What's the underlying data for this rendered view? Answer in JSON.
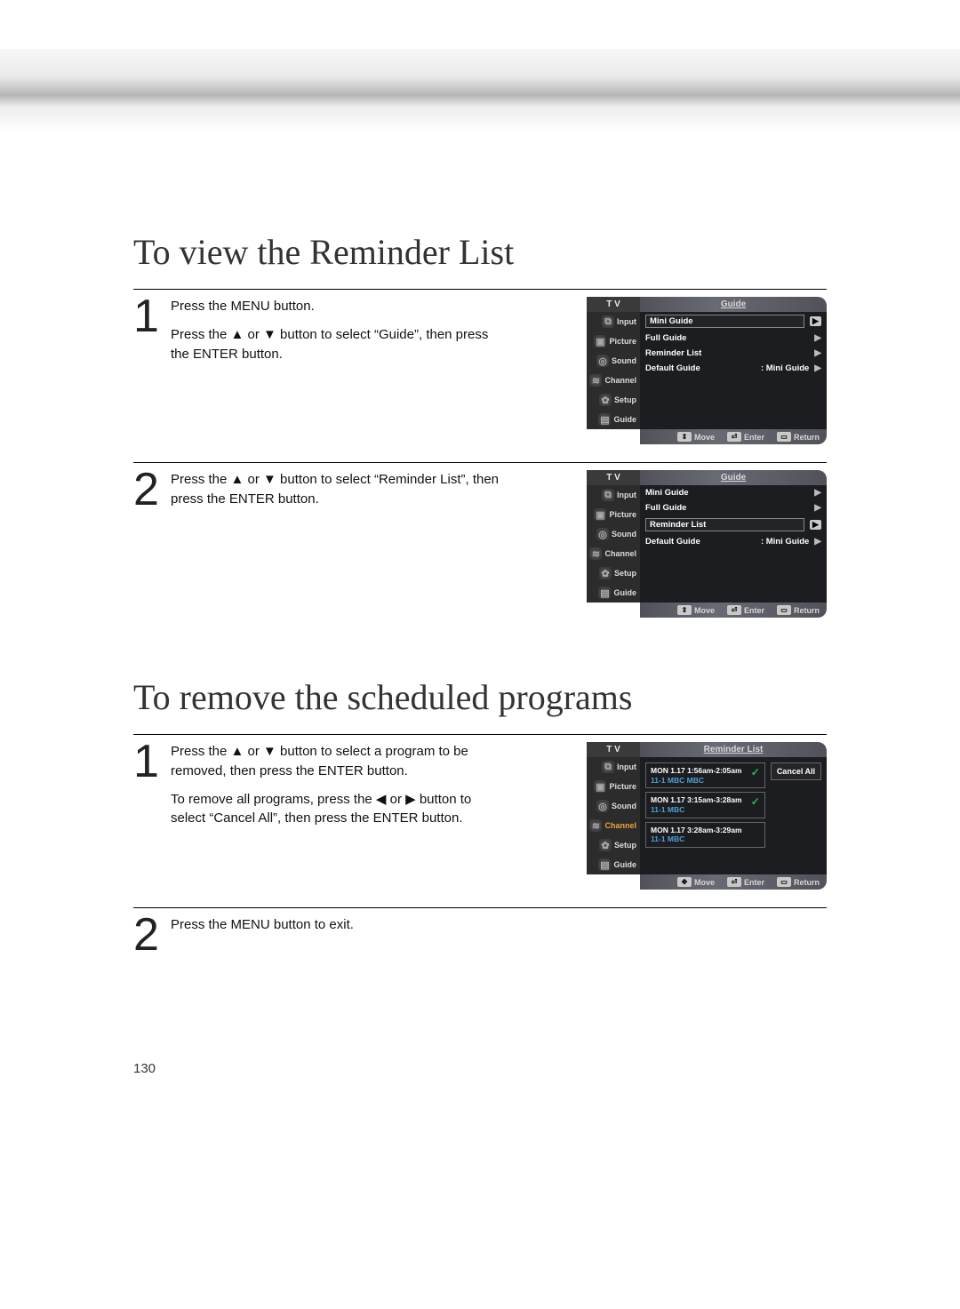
{
  "page_number": "130",
  "section1": {
    "title": "To view the Reminder List",
    "steps": [
      {
        "num": "1",
        "lines": [
          "Press the MENU button.",
          "Press the ▲ or ▼ button to select “Guide”, then press the ENTER button."
        ]
      },
      {
        "num": "2",
        "lines": [
          "Press the ▲ or ▼ button to select “Reminder List”, then press the ENTER button."
        ]
      }
    ]
  },
  "section2": {
    "title": "To remove the scheduled programs",
    "steps": [
      {
        "num": "1",
        "lines": [
          "Press the ▲ or ▼ button to select a program to be removed, then press the ENTER button.",
          "To remove all programs, press the ◀ or ▶ button to select “Cancel All”, then press the ENTER button."
        ]
      },
      {
        "num": "2",
        "lines": [
          "Press the MENU button to exit."
        ]
      }
    ]
  },
  "osd_common": {
    "tv_label": "T V",
    "sidebar": [
      "Input",
      "Picture",
      "Sound",
      "Channel",
      "Setup",
      "Guide"
    ],
    "footer": {
      "move": "Move",
      "enter": "Enter",
      "return": "Return"
    }
  },
  "osd_guide": {
    "title": "Guide",
    "options": [
      {
        "label": "Mini Guide",
        "value": ""
      },
      {
        "label": "Full Guide",
        "value": ""
      },
      {
        "label": "Reminder List",
        "value": ""
      },
      {
        "label": "Default Guide",
        "value": ": Mini Guide"
      }
    ]
  },
  "osd_reminder": {
    "title": "Reminder List",
    "cancel_all": "Cancel All",
    "items": [
      {
        "line1": "MON 1.17 1:56am-2:05am",
        "line2": "11-1  MBC     MBC"
      },
      {
        "line1": "MON 1.17 3:15am-3:28am",
        "line2": "11-1  MBC"
      },
      {
        "line1": "MON 1.17 3:28am-3:29am",
        "line2": "11-1  MBC"
      }
    ]
  }
}
